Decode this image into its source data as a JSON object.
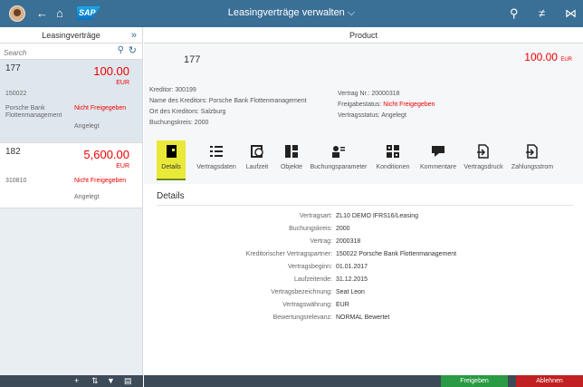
{
  "shell": {
    "title": "Leasingverträge verwalten ⌵",
    "logo": "SAP"
  },
  "master": {
    "header": "Leasingverträge",
    "search_placeholder": "Search",
    "items": [
      {
        "number": "177",
        "amount": "100.00",
        "currency": "EUR",
        "sub1": "150022",
        "sub2": "Porsche Bank\nFlottenmanagement",
        "status": "Nicht Freigegeben",
        "status2": "Angelegt"
      },
      {
        "number": "182",
        "amount": "5,600.00",
        "currency": "EUR",
        "sub1": "310810",
        "sub2": "",
        "status": "Nicht Freigegeben",
        "status2": "Angelegt"
      }
    ]
  },
  "detail": {
    "header": "Product",
    "title": "177",
    "amount": "100.00",
    "currency": "EUR",
    "left_attrs": [
      "Kreditor: 300199",
      "Name des Kreditors: Porsche Bank Flottenmanagement",
      "Ort des Kreditors: Salzburg",
      "Buchungskreis: 2000"
    ],
    "right_attrs": [
      {
        "label": "Vertrag Nr.: ",
        "value": "20000318",
        "red": false
      },
      {
        "label": "Freigabestatus: ",
        "value": "Nicht Freigegeben",
        "red": true
      },
      {
        "label": "Vertragsstatus: ",
        "value": "Angelegt",
        "red": false
      }
    ],
    "tabs": [
      "Details",
      "Vertragsdaten",
      "Laufzeit",
      "Objekte",
      "Buchungsparameter",
      "Konditionen",
      "Kommentare",
      "Vertragsdruck",
      "Zahlungsstrom"
    ],
    "section_title": "Details",
    "fields": [
      {
        "label": "Vertragsart:",
        "value": "ZL10 DEMO IFRS16/Leasing"
      },
      {
        "label": "Buchungskreis:",
        "value": "2000"
      },
      {
        "label": "Vertrag:",
        "value": "2000318"
      },
      {
        "label": "Kreditorischer Vertragspartner:",
        "value": "150022 Porsche Bank Flottenmanagement"
      },
      {
        "label": "Vertragsbeginn:",
        "value": "01.01.2017"
      },
      {
        "label": "Laufzeitende:",
        "value": "31.12.2015"
      },
      {
        "label": "Vertragsbezeichnung:",
        "value": "Seat Leon"
      },
      {
        "label": "Vertragswährung:",
        "value": "EUR"
      },
      {
        "label": "Bewertungsrelevanz:",
        "value": "NORMAL Bewertet"
      }
    ]
  },
  "footer": {
    "approve": "Freigeben",
    "reject": "Ablehnen"
  },
  "colors": {
    "shell": "#3a6f96",
    "accent_red": "#e00000",
    "active_tab": "#e9e93a",
    "approve": "#2b9a44",
    "reject": "#c12022"
  }
}
